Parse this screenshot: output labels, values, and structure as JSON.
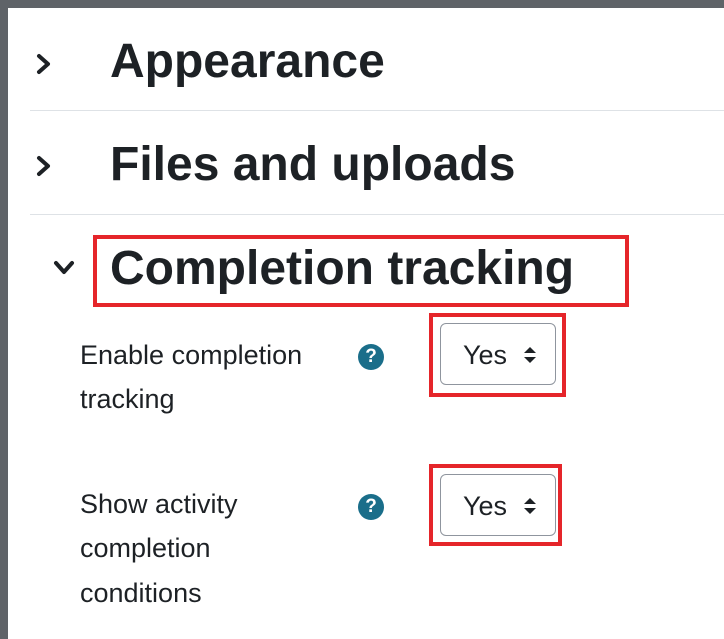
{
  "sections": [
    {
      "title": "Appearance",
      "state": "collapsed",
      "icon": "chevron-right-icon"
    },
    {
      "title": "Files and uploads",
      "state": "collapsed",
      "icon": "chevron-right-icon"
    },
    {
      "title": "Completion tracking",
      "state": "expanded",
      "icon": "chevron-down-icon"
    }
  ],
  "fields": [
    {
      "label_line1": "Enable completion",
      "label_line2": "tracking",
      "help_icon": "question-circle-icon",
      "help_glyph": "?",
      "value": "Yes"
    },
    {
      "label_line1": "Show activity",
      "label_line2": "completion",
      "label_line3": "conditions",
      "help_icon": "question-circle-icon",
      "help_glyph": "?",
      "value": "Yes"
    }
  ],
  "colors": {
    "highlight": "#e5252a",
    "help_icon": "#1a6e8a",
    "text": "#1d2125",
    "frame": "#5f6368"
  }
}
